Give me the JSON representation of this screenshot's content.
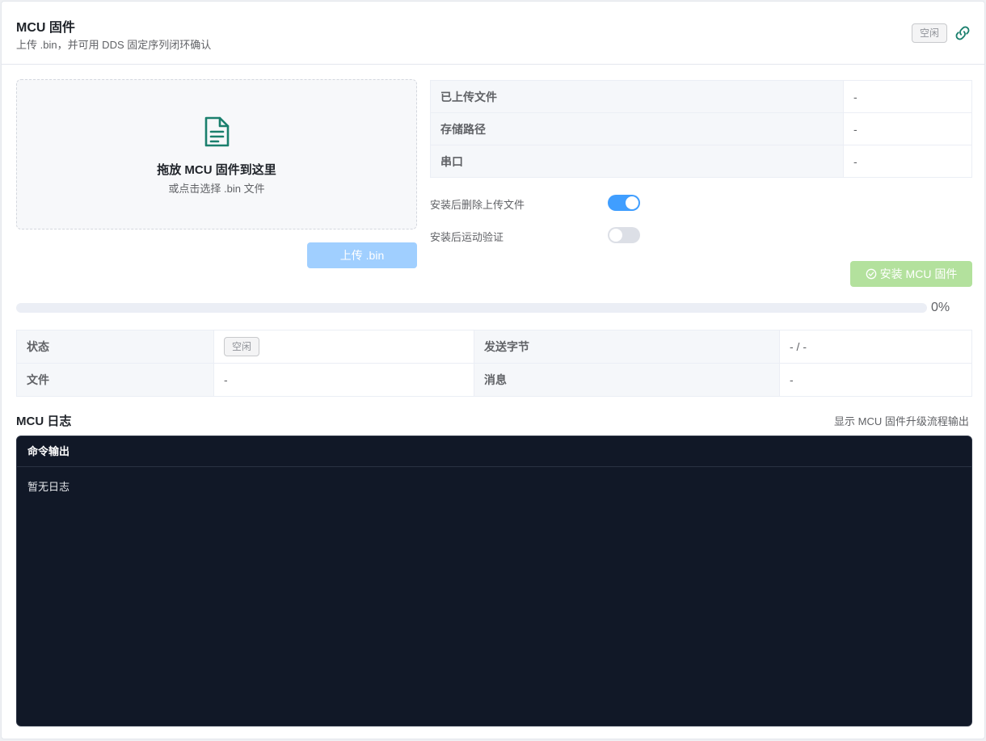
{
  "header": {
    "title": "MCU 固件",
    "subtitle": "上传 .bin，并可用 DDS 固定序列闭环确认",
    "status_tag": "空闲",
    "link_icon": "link-icon"
  },
  "upload": {
    "dropzone_icon": "document-icon",
    "dropzone_title": "拖放 MCU 固件到这里",
    "dropzone_hint": "或点击选择 .bin 文件",
    "upload_button": "上传 .bin"
  },
  "info": {
    "rows": [
      {
        "label": "已上传文件",
        "value": "-"
      },
      {
        "label": "存储路径",
        "value": "-"
      },
      {
        "label": "串口",
        "value": "-"
      }
    ]
  },
  "options": {
    "delete_after_install": {
      "label": "安装后删除上传文件",
      "enabled": true
    },
    "motion_verify": {
      "label": "安装后运动验证",
      "enabled": false
    }
  },
  "install_button": {
    "label": "安装 MCU 固件",
    "icon": "check-circle-icon"
  },
  "progress": {
    "percent": 0,
    "text": "0%"
  },
  "status": {
    "state_label": "状态",
    "state_value": "空闲",
    "bytes_label": "发送字节",
    "bytes_value": "- / -",
    "file_label": "文件",
    "file_value": "-",
    "message_label": "消息",
    "message_value": "-"
  },
  "log": {
    "title": "MCU 日志",
    "hint": "显示 MCU 固件升级流程输出",
    "terminal_title": "命令输出",
    "content": "暂无日志"
  },
  "colors": {
    "primary": "#409eff",
    "primary_disabled": "#a0cfff",
    "success_disabled": "#b3e19d",
    "terminal_bg": "#111827",
    "icon_teal": "#1a7f6d"
  }
}
